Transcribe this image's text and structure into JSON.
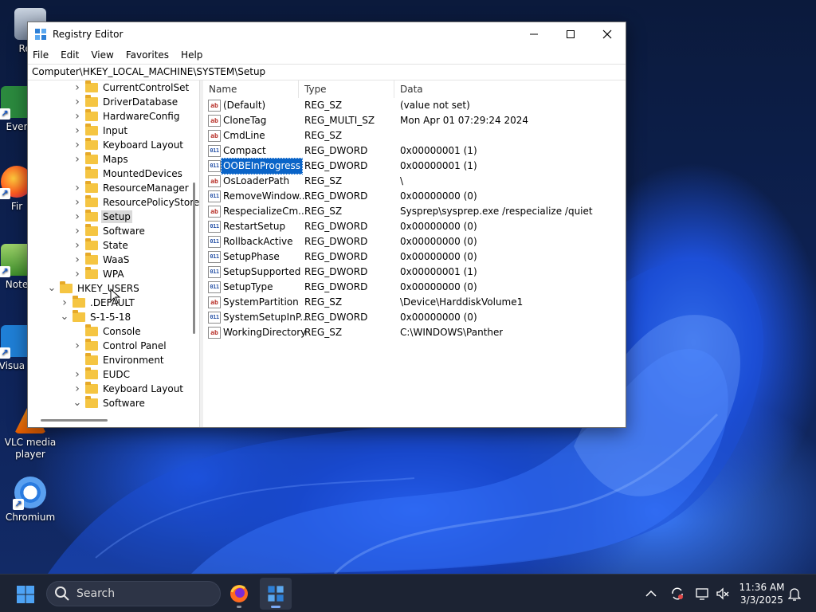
{
  "desktop": {
    "icons": [
      {
        "label": "Recy",
        "icon": "recycle-bin-icon"
      },
      {
        "label": "Ever",
        "icon": "app-shortcut-icon"
      },
      {
        "label": "Fir",
        "icon": "firefox-icon"
      },
      {
        "label": "Note",
        "icon": "notepad-icon"
      },
      {
        "label": "Visua C",
        "icon": "visual-studio-code-icon"
      },
      {
        "label": "VLC media player",
        "icon": "vlc-icon"
      },
      {
        "label": "Chromium",
        "icon": "chromium-icon"
      }
    ]
  },
  "window": {
    "title": "Registry Editor",
    "menu": [
      "File",
      "Edit",
      "View",
      "Favorites",
      "Help"
    ],
    "address": "Computer\\HKEY_LOCAL_MACHINE\\SYSTEM\\Setup",
    "tree": [
      {
        "label": "CurrentControlSet",
        "expander": "collapsed",
        "level": 3
      },
      {
        "label": "DriverDatabase",
        "expander": "collapsed",
        "level": 3
      },
      {
        "label": "HardwareConfig",
        "expander": "collapsed",
        "level": 3
      },
      {
        "label": "Input",
        "expander": "collapsed",
        "level": 3
      },
      {
        "label": "Keyboard Layout",
        "expander": "collapsed",
        "level": 3
      },
      {
        "label": "Maps",
        "expander": "collapsed",
        "level": 3
      },
      {
        "label": "MountedDevices",
        "expander": "none",
        "level": 3
      },
      {
        "label": "ResourceManager",
        "expander": "collapsed",
        "level": 3
      },
      {
        "label": "ResourcePolicyStore",
        "expander": "collapsed",
        "level": 3
      },
      {
        "label": "Setup",
        "expander": "collapsed",
        "level": 3,
        "selected": true
      },
      {
        "label": "Software",
        "expander": "collapsed",
        "level": 3
      },
      {
        "label": "State",
        "expander": "collapsed",
        "level": 3
      },
      {
        "label": "WaaS",
        "expander": "collapsed",
        "level": 3
      },
      {
        "label": "WPA",
        "expander": "collapsed",
        "level": 3
      },
      {
        "label": "HKEY_USERS",
        "expander": "expanded",
        "level": 1
      },
      {
        "label": ".DEFAULT",
        "expander": "collapsed",
        "level": 2
      },
      {
        "label": "S-1-5-18",
        "expander": "expanded",
        "level": 2
      },
      {
        "label": "Console",
        "expander": "none",
        "level": 3
      },
      {
        "label": "Control Panel",
        "expander": "collapsed",
        "level": 3
      },
      {
        "label": "Environment",
        "expander": "none",
        "level": 3
      },
      {
        "label": "EUDC",
        "expander": "collapsed",
        "level": 3
      },
      {
        "label": "Keyboard Layout",
        "expander": "collapsed",
        "level": 3
      },
      {
        "label": "Software",
        "expander": "expanded",
        "level": 3
      }
    ],
    "columns": {
      "name": "Name",
      "type": "Type",
      "data": "Data"
    },
    "values": [
      {
        "name": "(Default)",
        "type": "REG_SZ",
        "data": "(value not set)",
        "icon": "ab"
      },
      {
        "name": "CloneTag",
        "type": "REG_MULTI_SZ",
        "data": "Mon Apr 01 07:29:24 2024",
        "icon": "ab"
      },
      {
        "name": "CmdLine",
        "type": "REG_SZ",
        "data": "",
        "icon": "ab"
      },
      {
        "name": "Compact",
        "type": "REG_DWORD",
        "data": "0x00000001 (1)",
        "icon": "bin"
      },
      {
        "name": "OOBEInProgress",
        "type": "REG_DWORD",
        "data": "0x00000001 (1)",
        "icon": "bin",
        "selected": true
      },
      {
        "name": "OsLoaderPath",
        "type": "REG_SZ",
        "data": "\\",
        "icon": "ab"
      },
      {
        "name": "RemoveWindow...",
        "type": "REG_DWORD",
        "data": "0x00000000 (0)",
        "icon": "bin"
      },
      {
        "name": "RespecializeCm...",
        "type": "REG_SZ",
        "data": "Sysprep\\sysprep.exe /respecialize /quiet",
        "icon": "ab"
      },
      {
        "name": "RestartSetup",
        "type": "REG_DWORD",
        "data": "0x00000000 (0)",
        "icon": "bin"
      },
      {
        "name": "RollbackActive",
        "type": "REG_DWORD",
        "data": "0x00000000 (0)",
        "icon": "bin"
      },
      {
        "name": "SetupPhase",
        "type": "REG_DWORD",
        "data": "0x00000000 (0)",
        "icon": "bin"
      },
      {
        "name": "SetupSupported",
        "type": "REG_DWORD",
        "data": "0x00000001 (1)",
        "icon": "bin"
      },
      {
        "name": "SetupType",
        "type": "REG_DWORD",
        "data": "0x00000000 (0)",
        "icon": "bin"
      },
      {
        "name": "SystemPartition",
        "type": "REG_SZ",
        "data": "\\Device\\HarddiskVolume1",
        "icon": "ab"
      },
      {
        "name": "SystemSetupInP...",
        "type": "REG_DWORD",
        "data": "0x00000000 (0)",
        "icon": "bin"
      },
      {
        "name": "WorkingDirectory",
        "type": "REG_SZ",
        "data": "C:\\WINDOWS\\Panther",
        "icon": "ab"
      }
    ]
  },
  "taskbar": {
    "search_label": "Search",
    "apps": [
      "firefox-icon",
      "registry-editor-icon"
    ],
    "time": "11:36 AM",
    "date": "3/3/2025"
  },
  "colors": {
    "selection": "#0a64c8",
    "tree_selection": "#d9d9d9",
    "taskbar": "#1c2333"
  }
}
